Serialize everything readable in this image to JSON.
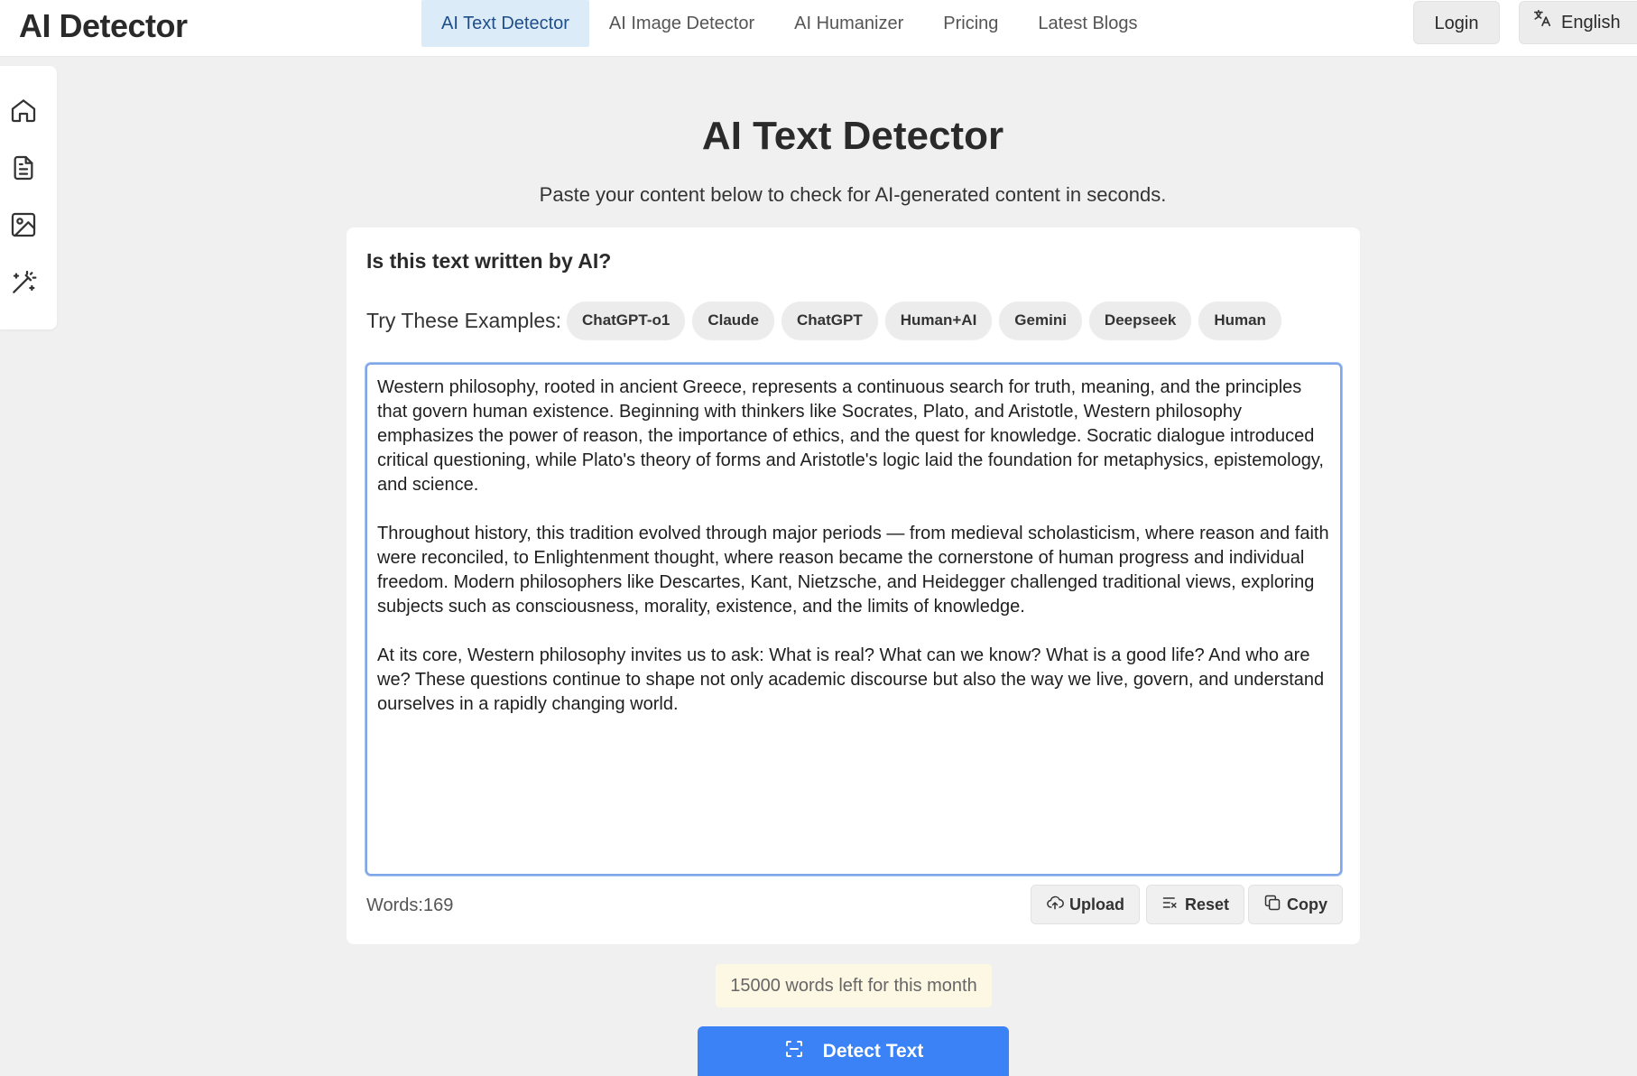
{
  "header": {
    "logo": "AI Detector",
    "nav": [
      {
        "label": "AI Text Detector",
        "active": true
      },
      {
        "label": "AI Image Detector",
        "active": false
      },
      {
        "label": "AI Humanizer",
        "active": false
      },
      {
        "label": "Pricing",
        "active": false
      },
      {
        "label": "Latest Blogs",
        "active": false
      }
    ],
    "login_label": "Login",
    "language_label": "English"
  },
  "sidebar": {
    "icons": [
      "home-icon",
      "document-icon",
      "image-icon",
      "magic-wand-icon"
    ]
  },
  "main": {
    "title": "AI Text Detector",
    "subtitle": "Paste your content below to check for AI-generated content in seconds."
  },
  "card": {
    "question": "Is this text written by AI?",
    "examples_label": "Try These Examples:",
    "examples": [
      "ChatGPT-o1",
      "Claude",
      "ChatGPT",
      "Human+AI",
      "Gemini",
      "Deepseek",
      "Human"
    ],
    "text": "Western philosophy, rooted in ancient Greece, represents a continuous search for truth, meaning, and the principles that govern human existence. Beginning with thinkers like Socrates, Plato, and Aristotle, Western philosophy emphasizes the power of reason, the importance of ethics, and the quest for knowledge. Socratic dialogue introduced critical questioning, while Plato's theory of forms and Aristotle's logic laid the foundation for metaphysics, epistemology, and science.\n\nThroughout history, this tradition evolved through major periods — from medieval scholasticism, where reason and faith were reconciled, to Enlightenment thought, where reason became the cornerstone of human progress and individual freedom. Modern philosophers like Descartes, Kant, Nietzsche, and Heidegger challenged traditional views, exploring subjects such as consciousness, morality, existence, and the limits of knowledge.\n\nAt its core, Western philosophy invites us to ask: What is real? What can we know? What is a good life? And who are we? These questions continue to shape not only academic discourse but also the way we live, govern, and understand ourselves in a rapidly changing world.",
    "word_count": "Words:169",
    "upload_label": "Upload",
    "reset_label": "Reset",
    "copy_label": "Copy"
  },
  "quota": "15000 words left for this month",
  "detect_label": "Detect Text",
  "colors": {
    "accent": "#3b82f6",
    "nav_active_bg": "#dcebf8",
    "quota_bg": "#fdf8e4"
  }
}
